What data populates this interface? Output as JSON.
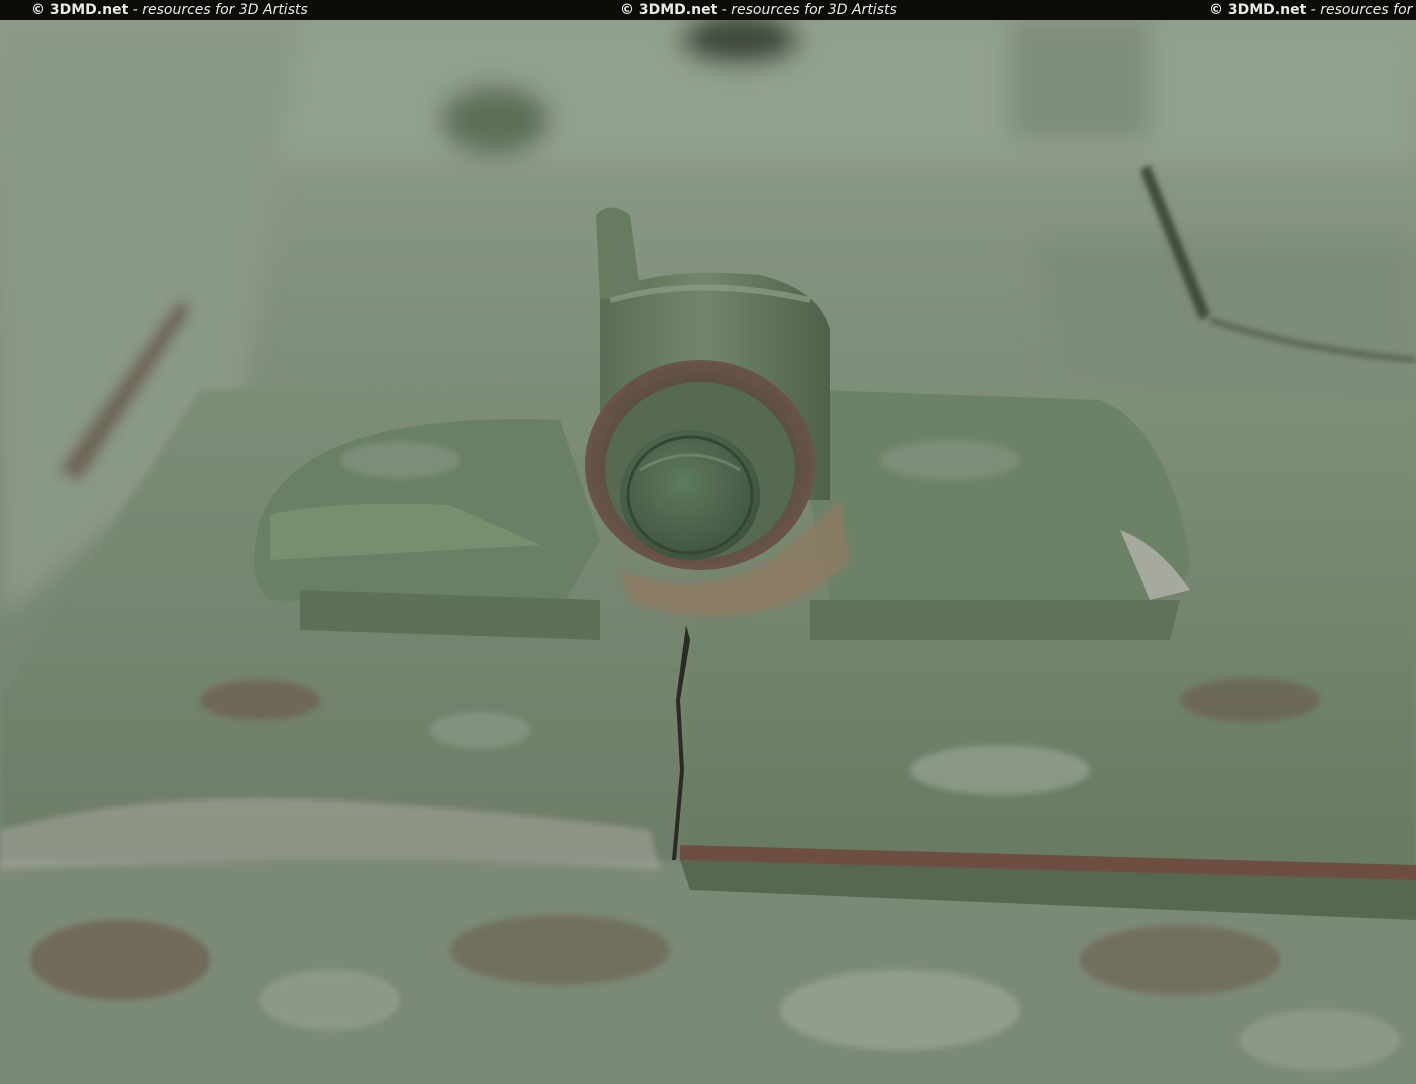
{
  "watermark": {
    "brand": "© 3DMD.net",
    "tagline": "resources for 3D Artists",
    "separator": "-"
  },
  "photo": {
    "subject": "close-up of a weathered green-painted steel hinge with hex bolt on armor plates",
    "colors": {
      "paint_green": "#6f8669",
      "paint_light": "#8e9c8a",
      "rust": "#7a5040",
      "dark_gap": "#2b2a24"
    }
  }
}
